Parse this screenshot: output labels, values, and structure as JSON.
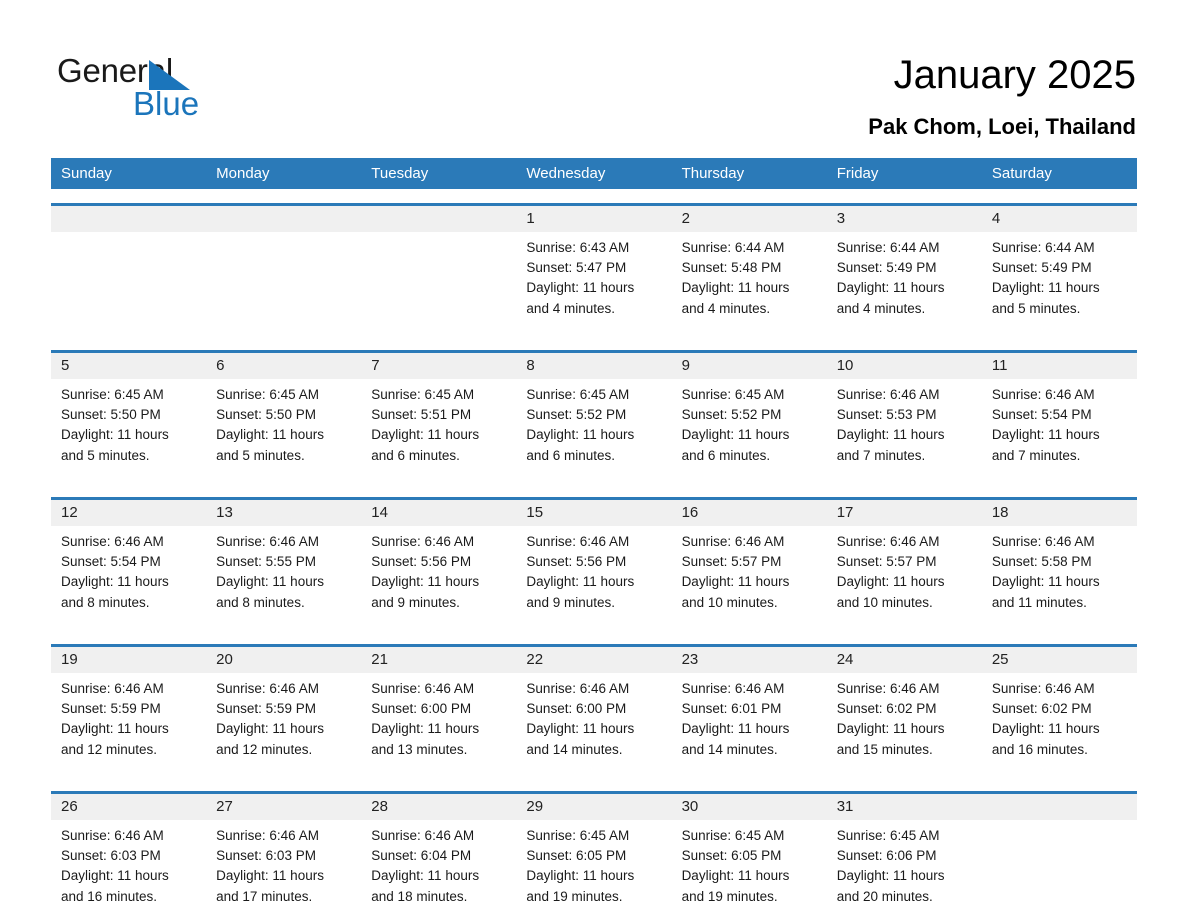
{
  "brand": {
    "name_part1": "General",
    "name_part2": "Blue"
  },
  "header": {
    "month_title": "January 2025",
    "location": "Pak Chom, Loei, Thailand"
  },
  "colors": {
    "header_blue": "#2b7ab8",
    "brand_blue": "#1b75bb",
    "day_band_gray": "#f0f0f0"
  },
  "weekdays": [
    "Sunday",
    "Monday",
    "Tuesday",
    "Wednesday",
    "Thursday",
    "Friday",
    "Saturday"
  ],
  "weeks": [
    {
      "numbers": [
        "",
        "",
        "",
        "1",
        "2",
        "3",
        "4"
      ],
      "cells": [
        {
          "sunrise": "",
          "sunset": "",
          "daylight_line1": "",
          "daylight_line2": ""
        },
        {
          "sunrise": "",
          "sunset": "",
          "daylight_line1": "",
          "daylight_line2": ""
        },
        {
          "sunrise": "",
          "sunset": "",
          "daylight_line1": "",
          "daylight_line2": ""
        },
        {
          "sunrise": "Sunrise: 6:43 AM",
          "sunset": "Sunset: 5:47 PM",
          "daylight_line1": "Daylight: 11 hours",
          "daylight_line2": "and 4 minutes."
        },
        {
          "sunrise": "Sunrise: 6:44 AM",
          "sunset": "Sunset: 5:48 PM",
          "daylight_line1": "Daylight: 11 hours",
          "daylight_line2": "and 4 minutes."
        },
        {
          "sunrise": "Sunrise: 6:44 AM",
          "sunset": "Sunset: 5:49 PM",
          "daylight_line1": "Daylight: 11 hours",
          "daylight_line2": "and 4 minutes."
        },
        {
          "sunrise": "Sunrise: 6:44 AM",
          "sunset": "Sunset: 5:49 PM",
          "daylight_line1": "Daylight: 11 hours",
          "daylight_line2": "and 5 minutes."
        }
      ]
    },
    {
      "numbers": [
        "5",
        "6",
        "7",
        "8",
        "9",
        "10",
        "11"
      ],
      "cells": [
        {
          "sunrise": "Sunrise: 6:45 AM",
          "sunset": "Sunset: 5:50 PM",
          "daylight_line1": "Daylight: 11 hours",
          "daylight_line2": "and 5 minutes."
        },
        {
          "sunrise": "Sunrise: 6:45 AM",
          "sunset": "Sunset: 5:50 PM",
          "daylight_line1": "Daylight: 11 hours",
          "daylight_line2": "and 5 minutes."
        },
        {
          "sunrise": "Sunrise: 6:45 AM",
          "sunset": "Sunset: 5:51 PM",
          "daylight_line1": "Daylight: 11 hours",
          "daylight_line2": "and 6 minutes."
        },
        {
          "sunrise": "Sunrise: 6:45 AM",
          "sunset": "Sunset: 5:52 PM",
          "daylight_line1": "Daylight: 11 hours",
          "daylight_line2": "and 6 minutes."
        },
        {
          "sunrise": "Sunrise: 6:45 AM",
          "sunset": "Sunset: 5:52 PM",
          "daylight_line1": "Daylight: 11 hours",
          "daylight_line2": "and 6 minutes."
        },
        {
          "sunrise": "Sunrise: 6:46 AM",
          "sunset": "Sunset: 5:53 PM",
          "daylight_line1": "Daylight: 11 hours",
          "daylight_line2": "and 7 minutes."
        },
        {
          "sunrise": "Sunrise: 6:46 AM",
          "sunset": "Sunset: 5:54 PM",
          "daylight_line1": "Daylight: 11 hours",
          "daylight_line2": "and 7 minutes."
        }
      ]
    },
    {
      "numbers": [
        "12",
        "13",
        "14",
        "15",
        "16",
        "17",
        "18"
      ],
      "cells": [
        {
          "sunrise": "Sunrise: 6:46 AM",
          "sunset": "Sunset: 5:54 PM",
          "daylight_line1": "Daylight: 11 hours",
          "daylight_line2": "and 8 minutes."
        },
        {
          "sunrise": "Sunrise: 6:46 AM",
          "sunset": "Sunset: 5:55 PM",
          "daylight_line1": "Daylight: 11 hours",
          "daylight_line2": "and 8 minutes."
        },
        {
          "sunrise": "Sunrise: 6:46 AM",
          "sunset": "Sunset: 5:56 PM",
          "daylight_line1": "Daylight: 11 hours",
          "daylight_line2": "and 9 minutes."
        },
        {
          "sunrise": "Sunrise: 6:46 AM",
          "sunset": "Sunset: 5:56 PM",
          "daylight_line1": "Daylight: 11 hours",
          "daylight_line2": "and 9 minutes."
        },
        {
          "sunrise": "Sunrise: 6:46 AM",
          "sunset": "Sunset: 5:57 PM",
          "daylight_line1": "Daylight: 11 hours",
          "daylight_line2": "and 10 minutes."
        },
        {
          "sunrise": "Sunrise: 6:46 AM",
          "sunset": "Sunset: 5:57 PM",
          "daylight_line1": "Daylight: 11 hours",
          "daylight_line2": "and 10 minutes."
        },
        {
          "sunrise": "Sunrise: 6:46 AM",
          "sunset": "Sunset: 5:58 PM",
          "daylight_line1": "Daylight: 11 hours",
          "daylight_line2": "and 11 minutes."
        }
      ]
    },
    {
      "numbers": [
        "19",
        "20",
        "21",
        "22",
        "23",
        "24",
        "25"
      ],
      "cells": [
        {
          "sunrise": "Sunrise: 6:46 AM",
          "sunset": "Sunset: 5:59 PM",
          "daylight_line1": "Daylight: 11 hours",
          "daylight_line2": "and 12 minutes."
        },
        {
          "sunrise": "Sunrise: 6:46 AM",
          "sunset": "Sunset: 5:59 PM",
          "daylight_line1": "Daylight: 11 hours",
          "daylight_line2": "and 12 minutes."
        },
        {
          "sunrise": "Sunrise: 6:46 AM",
          "sunset": "Sunset: 6:00 PM",
          "daylight_line1": "Daylight: 11 hours",
          "daylight_line2": "and 13 minutes."
        },
        {
          "sunrise": "Sunrise: 6:46 AM",
          "sunset": "Sunset: 6:00 PM",
          "daylight_line1": "Daylight: 11 hours",
          "daylight_line2": "and 14 minutes."
        },
        {
          "sunrise": "Sunrise: 6:46 AM",
          "sunset": "Sunset: 6:01 PM",
          "daylight_line1": "Daylight: 11 hours",
          "daylight_line2": "and 14 minutes."
        },
        {
          "sunrise": "Sunrise: 6:46 AM",
          "sunset": "Sunset: 6:02 PM",
          "daylight_line1": "Daylight: 11 hours",
          "daylight_line2": "and 15 minutes."
        },
        {
          "sunrise": "Sunrise: 6:46 AM",
          "sunset": "Sunset: 6:02 PM",
          "daylight_line1": "Daylight: 11 hours",
          "daylight_line2": "and 16 minutes."
        }
      ]
    },
    {
      "numbers": [
        "26",
        "27",
        "28",
        "29",
        "30",
        "31",
        ""
      ],
      "cells": [
        {
          "sunrise": "Sunrise: 6:46 AM",
          "sunset": "Sunset: 6:03 PM",
          "daylight_line1": "Daylight: 11 hours",
          "daylight_line2": "and 16 minutes."
        },
        {
          "sunrise": "Sunrise: 6:46 AM",
          "sunset": "Sunset: 6:03 PM",
          "daylight_line1": "Daylight: 11 hours",
          "daylight_line2": "and 17 minutes."
        },
        {
          "sunrise": "Sunrise: 6:46 AM",
          "sunset": "Sunset: 6:04 PM",
          "daylight_line1": "Daylight: 11 hours",
          "daylight_line2": "and 18 minutes."
        },
        {
          "sunrise": "Sunrise: 6:45 AM",
          "sunset": "Sunset: 6:05 PM",
          "daylight_line1": "Daylight: 11 hours",
          "daylight_line2": "and 19 minutes."
        },
        {
          "sunrise": "Sunrise: 6:45 AM",
          "sunset": "Sunset: 6:05 PM",
          "daylight_line1": "Daylight: 11 hours",
          "daylight_line2": "and 19 minutes."
        },
        {
          "sunrise": "Sunrise: 6:45 AM",
          "sunset": "Sunset: 6:06 PM",
          "daylight_line1": "Daylight: 11 hours",
          "daylight_line2": "and 20 minutes."
        },
        {
          "sunrise": "",
          "sunset": "",
          "daylight_line1": "",
          "daylight_line2": ""
        }
      ]
    }
  ]
}
